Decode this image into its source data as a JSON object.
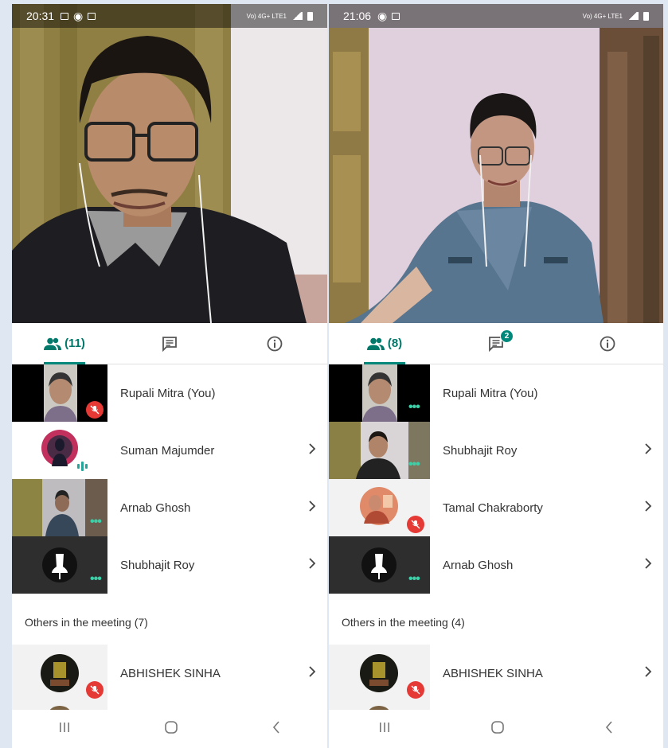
{
  "left": {
    "status": {
      "time": "20:31",
      "network": "Vo) 4G+ LTE1"
    },
    "tabs": {
      "participants_count": "(11)"
    },
    "participants": [
      {
        "name": "Rupali Mitra (You)",
        "state": "muted"
      },
      {
        "name": "Suman Majumder",
        "state": "speaking"
      },
      {
        "name": "Arnab Ghosh",
        "state": "video"
      },
      {
        "name": "Shubhajit Roy",
        "state": "dots"
      }
    ],
    "others_title": "Others in the meeting (7)",
    "others": [
      {
        "name": "ABHISHEK SINHA",
        "state": "muted"
      }
    ]
  },
  "right": {
    "status": {
      "time": "21:06",
      "network": "Vo) 4G+ LTE1"
    },
    "tabs": {
      "participants_count": "(8)",
      "chat_badge": "2"
    },
    "participants": [
      {
        "name": "Rupali Mitra (You)",
        "state": "dots"
      },
      {
        "name": "Shubhajit Roy",
        "state": "dots"
      },
      {
        "name": "Tamal Chakraborty",
        "state": "muted"
      },
      {
        "name": "Arnab Ghosh",
        "state": "dots"
      }
    ],
    "others_title": "Others in the meeting (4)",
    "others": [
      {
        "name": "ABHISHEK SINHA",
        "state": "muted"
      }
    ]
  },
  "colors": {
    "accent": "#00897b",
    "muted_red": "#e53935",
    "dots_green": "#3ad1a8",
    "page_bg": "#dfe8f2"
  },
  "icons": [
    "people-icon",
    "chat-icon",
    "info-icon",
    "chevron-right-icon",
    "mic-off-icon",
    "recents-icon",
    "home-icon",
    "back-icon"
  ]
}
